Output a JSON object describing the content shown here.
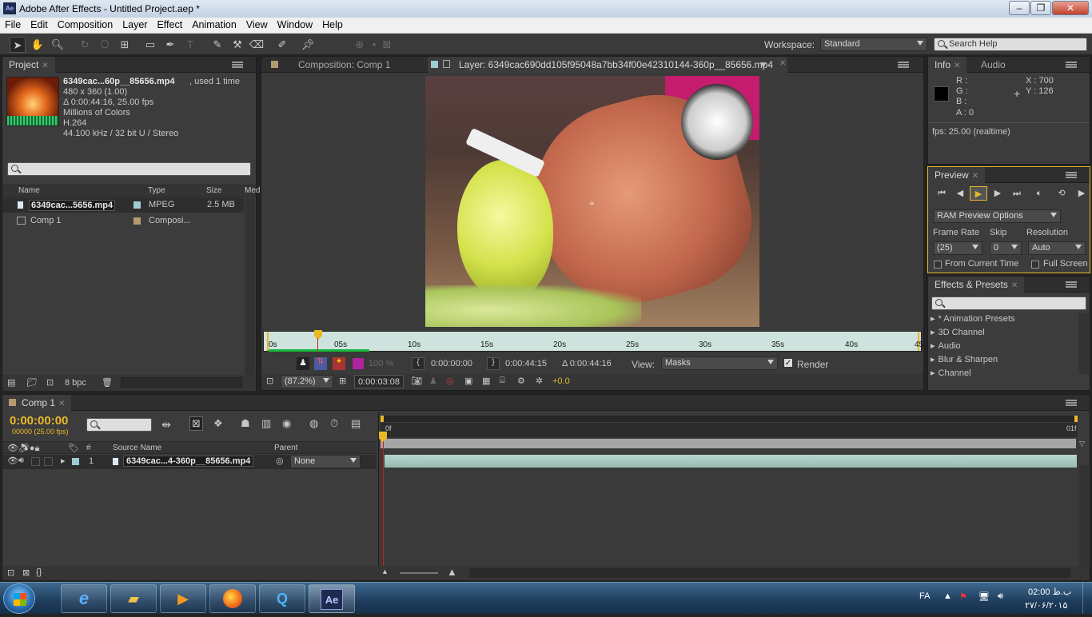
{
  "window": {
    "title": "Adobe After Effects - Untitled Project.aep *",
    "app_icon": "Ae"
  },
  "menu": [
    "File",
    "Edit",
    "Composition",
    "Layer",
    "Effect",
    "Animation",
    "View",
    "Window",
    "Help"
  ],
  "toolbar": {
    "workspace_label": "Workspace:",
    "workspace_value": "Standard",
    "search_placeholder": "Search Help"
  },
  "project": {
    "tab": "Project",
    "file_name": "6349cac...60p__85656.mp4",
    "used": ", used 1 time",
    "lines": [
      "480 x 360 (1.00)",
      "Δ 0:00:44:16, 25.00 fps",
      "Millions of Colors",
      "H.264",
      "44.100 kHz / 32 bit U / Stereo"
    ],
    "columns": {
      "name": "Name",
      "type": "Type",
      "size": "Size",
      "media": "Med"
    },
    "items": [
      {
        "name": "6349cac...5656.mp4",
        "type": "MPEG",
        "size": "2.5 MB",
        "label_color": "#9fc9d3"
      },
      {
        "name": "Comp 1",
        "type": "Composi...",
        "size": "",
        "label_color": "#b49a6e"
      }
    ],
    "bpc": "8 bpc"
  },
  "viewer": {
    "tab_comp": "Composition: Comp 1",
    "tab_layer": "Layer: 6349cac690dd105f95048a7bb34f00e42310144-360p__85656.mp4",
    "ruler_labels": [
      "0s",
      "05s",
      "10s",
      "15s",
      "20s",
      "25s",
      "30s",
      "35s",
      "40s",
      "45"
    ],
    "in_time": "0:00:00:00",
    "out_time": "0:00:44:15",
    "duration": "Δ 0:00:44:16",
    "view_label": "View:",
    "view_value": "Masks",
    "render_label": "Render",
    "zoom": "(87.2%)",
    "timecode": "0:00:03:08",
    "exposure": "+0.0",
    "percent": "100 %"
  },
  "info": {
    "tab_info": "Info",
    "tab_audio": "Audio",
    "rgba": [
      "R :",
      "G :",
      "B :",
      "A : 0"
    ],
    "x": "X : 700",
    "y": "Y : 126",
    "fps": "fps: 25.00 (realtime)"
  },
  "preview": {
    "tab": "Preview",
    "ram_options": "RAM Preview Options",
    "frame_rate_label": "Frame Rate",
    "skip_label": "Skip",
    "resolution_label": "Resolution",
    "frame_rate": "(25)",
    "skip": "0",
    "resolution": "Auto",
    "from_current": "From Current Time",
    "full_screen": "Full Screen"
  },
  "effects": {
    "tab": "Effects & Presets",
    "items": [
      "* Animation Presets",
      "3D Channel",
      "Audio",
      "Blur & Sharpen",
      "Channel"
    ]
  },
  "timeline": {
    "tab": "Comp 1",
    "timecode": "0:00:00:00",
    "sub": "00000 (25.00 fps)",
    "col_hash": "#",
    "col_source": "Source Name",
    "col_parent": "Parent",
    "layer_index": "1",
    "layer_name": "6349cac...4-360p__85656.mp4",
    "parent_value": "None",
    "ruler_start": "0f",
    "ruler_end": "01f"
  },
  "taskbar": {
    "lang": "FA",
    "time": "02:00 ب.ظ",
    "date": "۲۷/۰۶/۲۰۱۵"
  }
}
